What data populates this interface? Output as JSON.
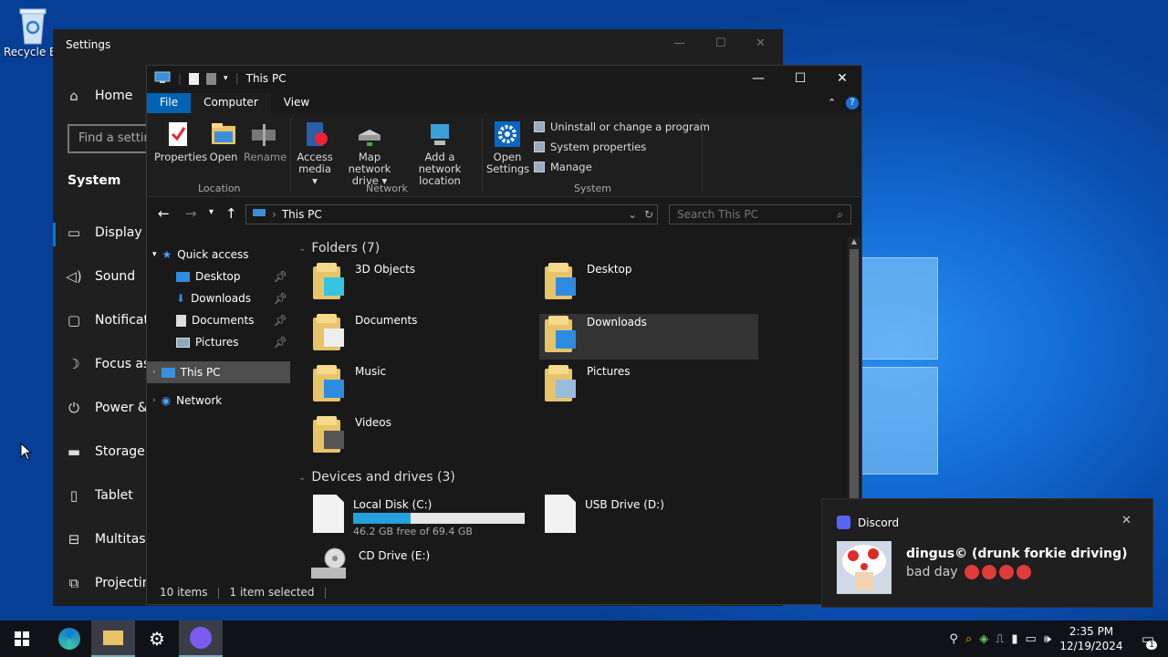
{
  "desktop": {
    "recycle_label": "Recycle Bin"
  },
  "settings": {
    "title": "Settings",
    "home": "Home",
    "search_placeholder": "Find a setting",
    "section": "System",
    "nav": [
      {
        "label": "Display",
        "icon": "monitor-icon"
      },
      {
        "label": "Sound",
        "icon": "speaker-icon"
      },
      {
        "label": "Notifications & actions",
        "icon": "notification-icon"
      },
      {
        "label": "Focus assist",
        "icon": "moon-icon"
      },
      {
        "label": "Power & sleep",
        "icon": "power-icon"
      },
      {
        "label": "Storage",
        "icon": "storage-icon"
      },
      {
        "label": "Tablet",
        "icon": "tablet-icon"
      },
      {
        "label": "Multitasking",
        "icon": "multitask-icon"
      },
      {
        "label": "Projecting to this PC",
        "icon": "project-icon"
      }
    ]
  },
  "explorer": {
    "title": "This PC",
    "tabs": [
      "File",
      "Computer",
      "View"
    ],
    "ribbon": {
      "properties": "Properties",
      "open": "Open",
      "rename": "Rename",
      "access_media": "Access media",
      "map_drive": "Map network drive",
      "add_location": "Add a network location",
      "open_settings": "Open Settings",
      "uninstall": "Uninstall or change a program",
      "system_properties": "System properties",
      "manage": "Manage",
      "grp_location": "Location",
      "grp_network": "Network",
      "grp_system": "System"
    },
    "address": "This PC",
    "search_placeholder": "Search This PC",
    "nav": {
      "quick_access": "Quick access",
      "desktop": "Desktop",
      "downloads": "Downloads",
      "documents": "Documents",
      "pictures": "Pictures",
      "this_pc": "This PC",
      "network": "Network"
    },
    "folders_header": "Folders (7)",
    "folders": [
      "3D Objects",
      "Desktop",
      "Documents",
      "Downloads",
      "Music",
      "Pictures",
      "Videos"
    ],
    "drives_header": "Devices and drives (3)",
    "drives": {
      "c_name": "Local Disk (C:)",
      "c_free": "46.2 GB free of 69.4 GB",
      "c_used_fraction": 0.334,
      "d_name": "USB Drive (D:)",
      "e_name": "CD Drive (E:)"
    },
    "status": {
      "items": "10 items",
      "selected": "1 item selected"
    }
  },
  "toast": {
    "app": "Discord",
    "title": "dingus© (drunk forkie driving)",
    "body": "bad day"
  },
  "taskbar": {
    "time": "2:35 PM",
    "date": "12/19/2024",
    "notif_count": "1"
  },
  "colors": {
    "accent": "#0078d4",
    "drive_bar": "#26a0da",
    "discord": "#5865f2"
  }
}
